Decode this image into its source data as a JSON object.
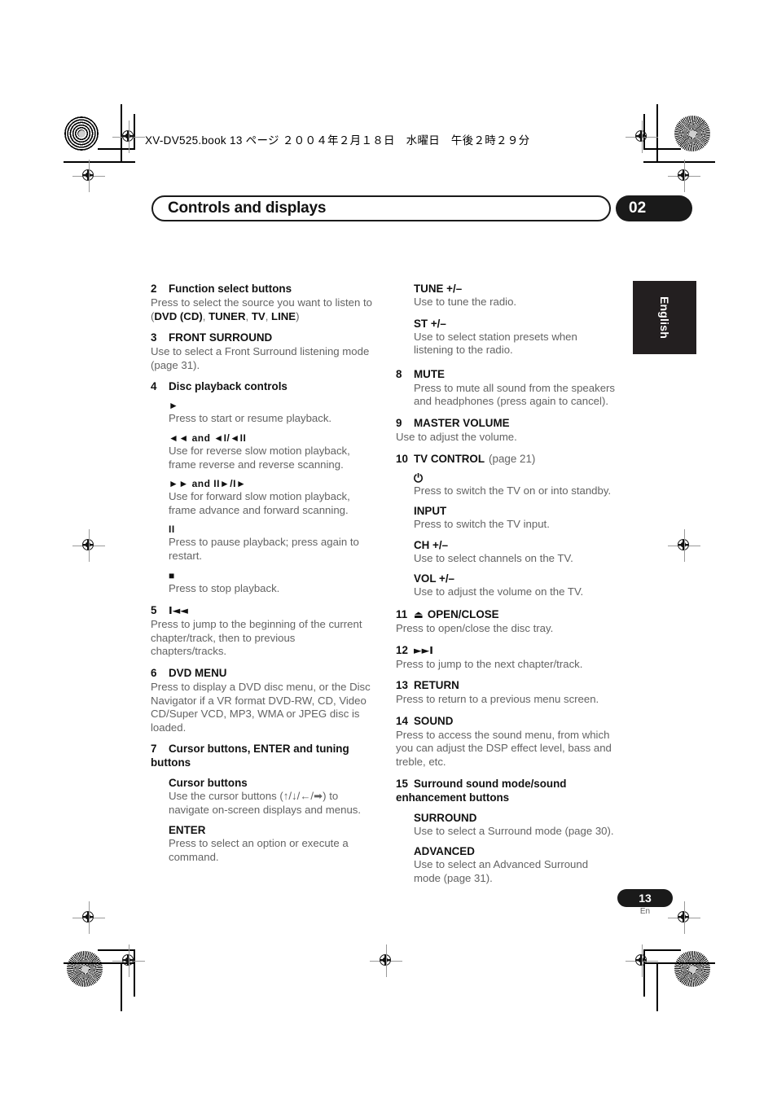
{
  "book_header": "XV-DV525.book  13 ページ  ２００４年２月１８日　水曜日　午後２時２９分",
  "title_bar": {
    "title": "Controls and displays",
    "chapter_number": "02"
  },
  "language_tab": "English",
  "footer": {
    "page_number": "13",
    "page_language": "En"
  },
  "left_column": {
    "item2": {
      "num": "2",
      "head": "Function select buttons",
      "body_pre": "Press to select the source you want to listen to (",
      "b1": "DVD (CD)",
      "sep1": ", ",
      "b2": "TUNER",
      "sep2": ", ",
      "b3": "TV",
      "sep3": ", ",
      "b4": "LINE",
      "body_post": ")"
    },
    "item3": {
      "num": "3",
      "head": "FRONT SURROUND",
      "body": "Use to select a Front Surround listening mode (page 31)."
    },
    "item4": {
      "num": "4",
      "head": "Disc playback controls",
      "subs": [
        {
          "glyph": "►",
          "body": "Press to start or resume playback."
        },
        {
          "glyph": "◄◄ and ◄I/◄II",
          "body": "Use for reverse slow motion playback, frame reverse and reverse scanning."
        },
        {
          "glyph": "►► and II►/I►",
          "body": "Use for forward slow motion playback, frame advance and forward scanning."
        },
        {
          "glyph": "II",
          "body": "Press to pause playback; press again to restart."
        },
        {
          "glyph": "■",
          "body": "Press to stop playback."
        }
      ]
    },
    "item5": {
      "num": "5",
      "glyph": "I◄◄",
      "body": "Press to jump to the beginning of the current chapter/track, then to previous chapters/tracks."
    },
    "item6": {
      "num": "6",
      "head": "DVD MENU",
      "body": "Press to display a DVD disc menu, or the Disc Navigator if a VR format DVD-RW, CD, Video CD/Super VCD, MP3, WMA or JPEG disc is loaded."
    },
    "item7": {
      "num": "7",
      "head": "Cursor buttons, ENTER and tuning buttons",
      "subs": [
        {
          "head": "Cursor buttons",
          "body": "Use the cursor buttons (↑/↓/←/➡) to navigate on-screen displays and menus."
        },
        {
          "head": "ENTER",
          "body": "Press to select an option or execute a command."
        }
      ]
    }
  },
  "right_column": {
    "tune": {
      "head": "TUNE +/–",
      "body": "Use to tune the radio."
    },
    "st": {
      "head": "ST +/–",
      "body": "Use to select station presets when listening to the radio."
    },
    "item8": {
      "num": "8",
      "head": "MUTE",
      "body": "Press to mute all sound from the speakers and headphones (press again to cancel)."
    },
    "item9": {
      "num": "9",
      "head": "MASTER VOLUME",
      "body": "Use to adjust the volume."
    },
    "item10": {
      "num": "10",
      "head": "TV CONTROL",
      "page_ref": "(page 21)",
      "subs": [
        {
          "glyph": "⏻",
          "body": "Press to switch the TV on or into standby."
        },
        {
          "head": "INPUT",
          "body": "Press to switch the TV input."
        },
        {
          "head": "CH +/–",
          "body": "Use to select channels on the TV."
        },
        {
          "head": "VOL +/–",
          "body": "Use to adjust the volume on the TV."
        }
      ]
    },
    "item11": {
      "num": "11",
      "glyph": "⏏",
      "head": "OPEN/CLOSE",
      "body": "Press to open/close the disc tray."
    },
    "item12": {
      "num": "12",
      "glyph": "►►I",
      "body": "Press to jump to the next chapter/track."
    },
    "item13": {
      "num": "13",
      "head": "RETURN",
      "body": "Press to return to a previous menu screen."
    },
    "item14": {
      "num": "14",
      "head": "SOUND",
      "body": "Press to access the sound menu, from which you can adjust the DSP effect level, bass and treble, etc."
    },
    "item15": {
      "num": "15",
      "head": "Surround sound mode/sound enhancement buttons",
      "subs": [
        {
          "head": "SURROUND",
          "body": "Use to select a Surround mode (page 30)."
        },
        {
          "head": "ADVANCED",
          "body": "Use to select an Advanced Surround mode (page 31)."
        }
      ]
    }
  }
}
